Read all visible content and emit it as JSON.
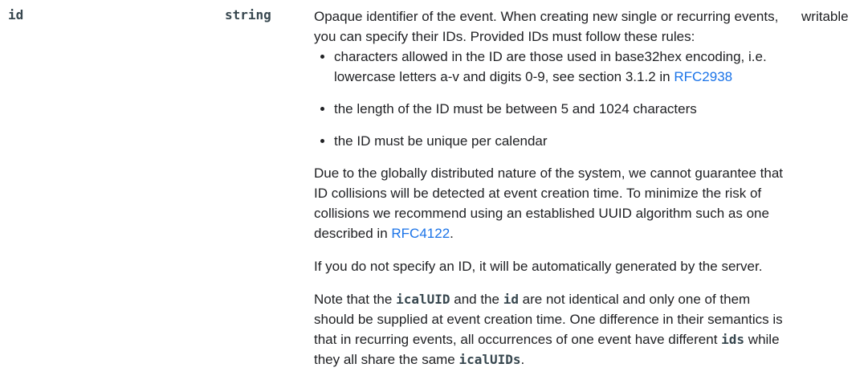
{
  "property": {
    "name": "id",
    "type": "string",
    "notes": "writable"
  },
  "description": {
    "intro": "Opaque identifier of the event. When creating new single or recurring events, you can specify their IDs. Provided IDs must follow these rules:",
    "rules": [
      {
        "text": "characters allowed in the ID are those used in base32hex encoding, i.e. lowercase letters a-v and digits 0-9, see section 3.1.2 in ",
        "link": "RFC2938"
      },
      {
        "text": "the length of the ID must be between 5 and 1024 characters"
      },
      {
        "text": "the ID must be unique per calendar"
      }
    ],
    "collision_para": {
      "text": "Due to the globally distributed nature of the system, we cannot guarantee that ID collisions will be detected at event creation time. To minimize the risk of collisions we recommend using an established UUID algorithm such as one described in ",
      "link": "RFC4122",
      "suffix": "."
    },
    "auto_para": "If you do not specify an ID, it will be automatically generated by the server.",
    "note_para": {
      "part1": "Note that the ",
      "code1": "icalUID",
      "part2": " and the ",
      "code2": "id",
      "part3": " are not identical and only one of them should be supplied at event creation time. One difference in their semantics is that in recurring events, all occurrences of one event have different ",
      "code3": "ids",
      "part4": " while they all share the same ",
      "code4": "icalUIDs",
      "part5": "."
    }
  }
}
